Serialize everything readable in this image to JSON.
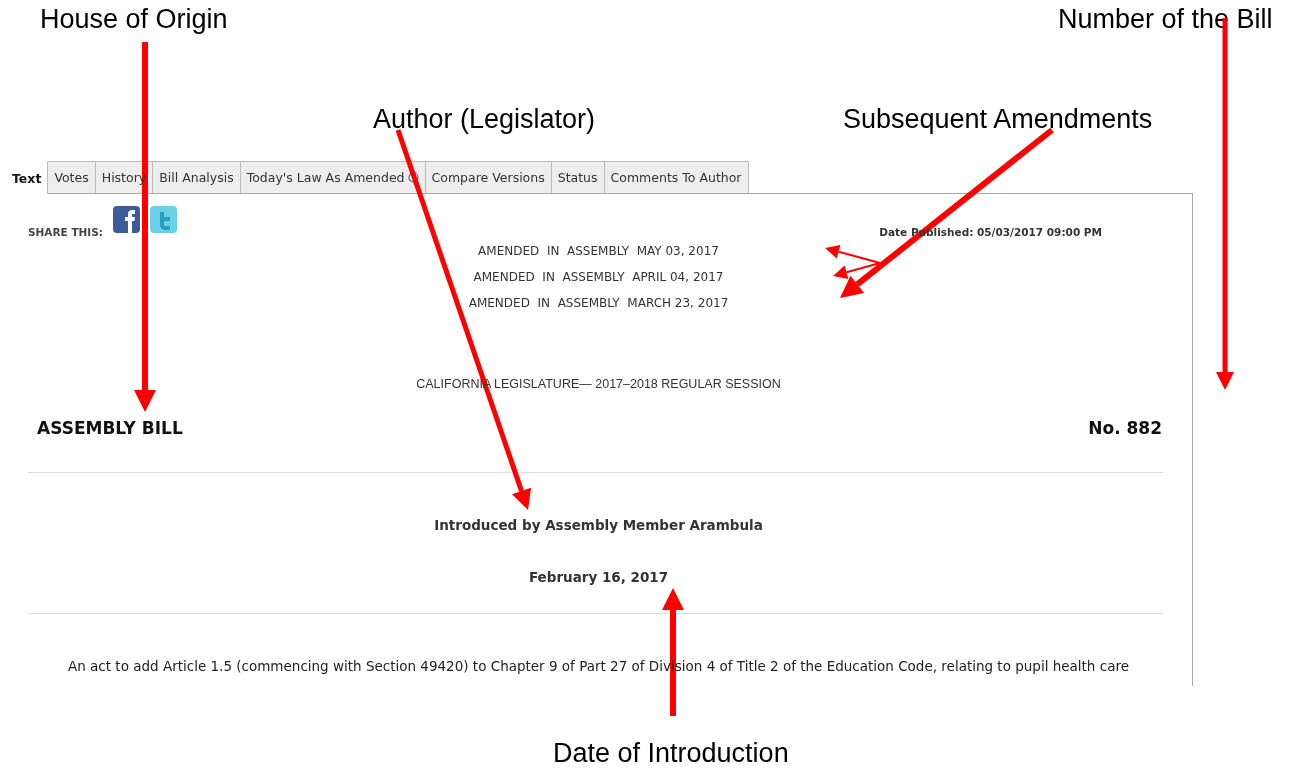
{
  "annotations": [
    {
      "label": "House of Origin"
    },
    {
      "label": "Number of the Bill"
    },
    {
      "label": "Author (Legislator)"
    },
    {
      "label": "Subsequent Amendments"
    },
    {
      "label": "Date of Introduction"
    }
  ],
  "tabs": [
    {
      "label": "Text",
      "selected": true
    },
    {
      "label": "Votes",
      "selected": false
    },
    {
      "label": "History",
      "selected": false
    },
    {
      "label": "Bill Analysis",
      "selected": false
    },
    {
      "label": "Today's Law As Amended",
      "selected": false,
      "info": true
    },
    {
      "label": "Compare Versions",
      "selected": false
    },
    {
      "label": "Status",
      "selected": false
    },
    {
      "label": "Comments To Author",
      "selected": false
    }
  ],
  "share": {
    "label": "SHARE THIS:"
  },
  "date_published": "Date Published: 05/03/2017 09:00 PM",
  "amendments": [
    "AMENDED  IN  ASSEMBLY  MAY 03, 2017",
    "AMENDED  IN  ASSEMBLY  APRIL 04, 2017",
    "AMENDED  IN  ASSEMBLY  MARCH 23, 2017"
  ],
  "session": "CALIFORNIA LEGISLATURE— 2017–2018 REGULAR SESSION",
  "house": "ASSEMBLY BILL",
  "number": "No. 882",
  "introduced_by": "Introduced by Assembly Member Arambula",
  "introduced_date": "February 16, 2017",
  "act": "An act to add Article 1.5 (commencing with Section 49420) to Chapter 9 of Part 27 of Division 4 of Title 2 of the Education Code, relating to pupil health care"
}
